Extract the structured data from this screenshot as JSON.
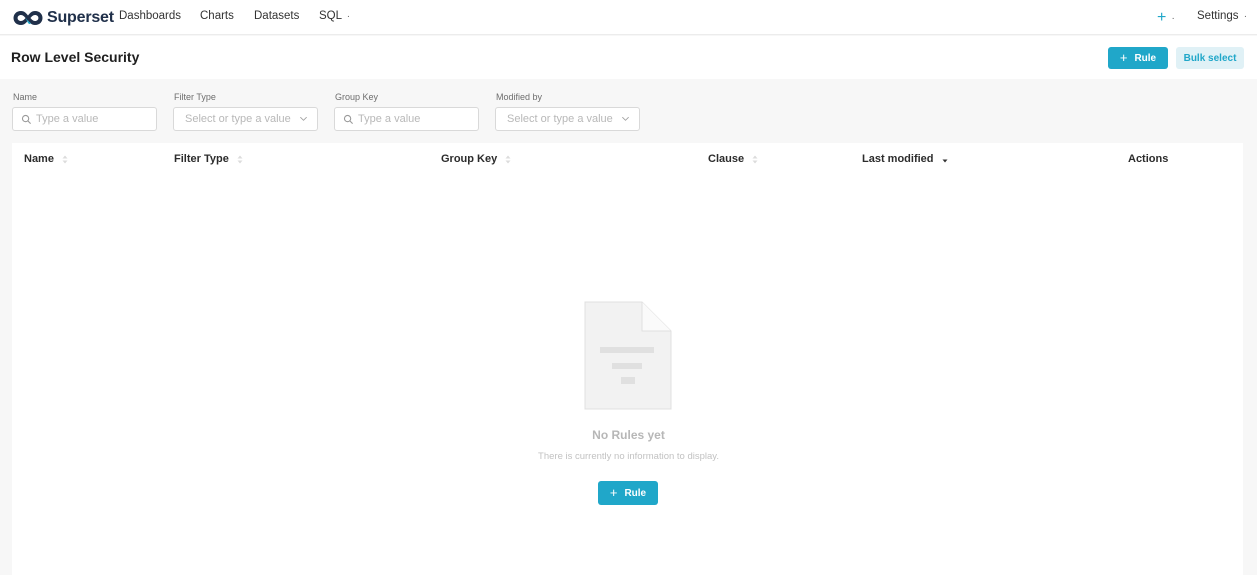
{
  "nav": {
    "brand": "Superset",
    "items": [
      {
        "label": "Dashboards"
      },
      {
        "label": "Charts"
      },
      {
        "label": "Datasets"
      },
      {
        "label": "SQL",
        "caret": "·"
      }
    ],
    "right": {
      "plus_label": "+",
      "plus_caret": "·",
      "settings_label": "Settings",
      "settings_caret": "·"
    }
  },
  "header": {
    "title": "Row Level Security",
    "rule_button": "Rule",
    "rule_button_icon": "+",
    "bulk_select": "Bulk select"
  },
  "filters": {
    "name": {
      "label": "Name",
      "placeholder": "Type a value",
      "icon": "search-icon"
    },
    "filter_type": {
      "label": "Filter Type",
      "placeholder": "Select or type a value",
      "icon": "chevron-down-icon"
    },
    "group_key": {
      "label": "Group Key",
      "placeholder": "Type a value",
      "icon": "search-icon"
    },
    "modified_by": {
      "label": "Modified by",
      "placeholder": "Select or type a value",
      "icon": "chevron-down-icon"
    }
  },
  "table": {
    "columns": [
      {
        "label": "Name",
        "sort": "unsorted"
      },
      {
        "label": "Filter Type",
        "sort": "unsorted"
      },
      {
        "label": "Group Key",
        "sort": "unsorted"
      },
      {
        "label": "Clause",
        "sort": "unsorted"
      },
      {
        "label": "Last modified",
        "sort": "descending"
      },
      {
        "label": "Actions",
        "sort": "none"
      }
    ],
    "rows": []
  },
  "empty_state": {
    "title": "No Rules yet",
    "description": "There is currently no information to display.",
    "button_icon": "+",
    "button_label": "Rule",
    "illustration": "empty-document-icon"
  },
  "colors": {
    "primary": "#20a7c9",
    "primary_light": "#e0f1f6",
    "brand_dark": "#20304a",
    "background": "#f7f7f7"
  }
}
